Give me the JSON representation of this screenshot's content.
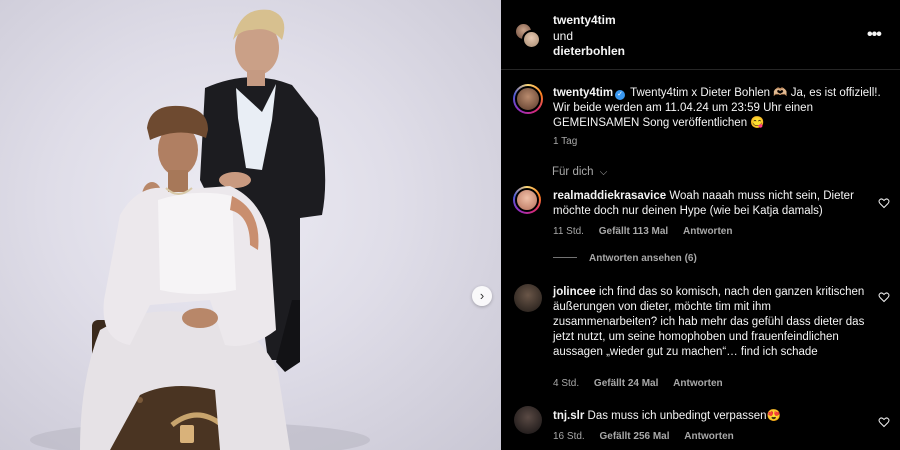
{
  "post": {
    "header": {
      "user1": "twenty4tim",
      "conjunction": "und",
      "user2": "dieterbohlen",
      "more_icon": "more-horizontal-icon",
      "more_label": "•••"
    },
    "caption": {
      "user": "twenty4tim",
      "verified_icon": "verified-badge-icon",
      "verified_glyph": "✓",
      "text": "Twenty4tim x Dieter Bohlen 🫶🏼 Ja, es ist offiziell!. Wir beide werden am 11.04.24 um 23:59 Uhr einen GEMEINSAMEN Song veröffentlichen 😋",
      "time": "1 Tag"
    },
    "for_you_label": "Für dich",
    "for_you_chevron": "⌵",
    "next_glyph": "›",
    "comments": [
      {
        "user": "realmaddiekrasavice",
        "text": "Woah naaah muss nicht sein, Dieter möchte doch nur deinen Hype (wie bei Katja damals)",
        "time": "11 Std.",
        "likes": "Gefällt 113 Mal",
        "reply": "Antworten",
        "view_replies": "Antworten ansehen (6)"
      },
      {
        "user": "jolincee",
        "text": "ich find das so komisch, nach den ganzen kritischen äußerungen von dieter, möchte tim mit ihm zusammenarbeiten? ich hab mehr das gefühl dass dieter das jetzt nutzt, um seine homophoben und frauenfeindlichen aussagen „wieder gut zu machen“… find ich schade",
        "time": "4 Std.",
        "likes": "Gefällt 24 Mal",
        "reply": "Antworten"
      },
      {
        "user": "tnj.slr",
        "text": "Das muss ich unbedingt verpassen😍",
        "time": "16 Std.",
        "likes": "Gefällt 256 Mal",
        "reply": "Antworten"
      }
    ]
  },
  "colors": {
    "background": "#000000",
    "text": "#f5f5f5",
    "secondary_text": "#a8a8a8",
    "verified": "#3897f0",
    "photo_backdrop": "#e6e4ee"
  }
}
